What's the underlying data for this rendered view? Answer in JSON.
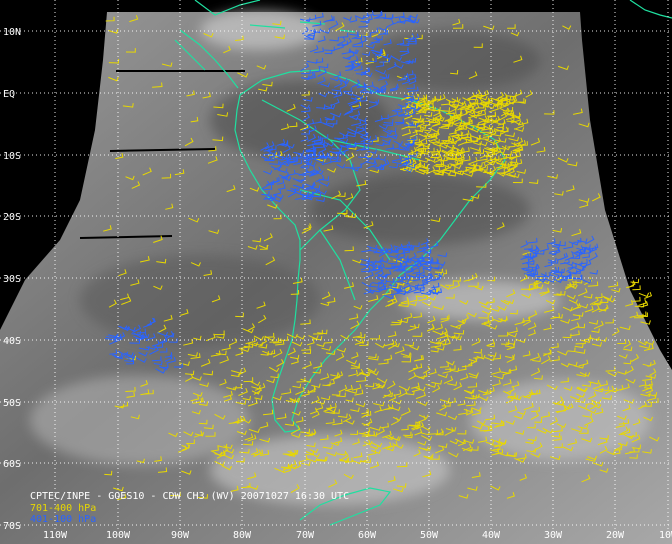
{
  "caption": "CPTEC/INPE - GOES10 - CDW CH3 (WV) 20071027 16:30 UTC",
  "legend": [
    {
      "label": "701-400 hPa",
      "color": "#e8d800"
    },
    {
      "label": "401-100 hPa",
      "color": "#2a64ff"
    }
  ],
  "lat_labels": [
    "10N",
    "EQ",
    "10S",
    "20S",
    "30S",
    "40S",
    "50S",
    "60S",
    "70S"
  ],
  "lon_labels": [
    "110W",
    "100W",
    "90W",
    "80W",
    "70W",
    "60W",
    "50W",
    "40W",
    "30W",
    "20W",
    "10W"
  ],
  "colors": {
    "background": "#000000",
    "coast": "#1fe0a0",
    "grid": "#ffffff",
    "image_gray": "#8c8c8c"
  },
  "wind_layers": [
    {
      "name": "701-400 hPa",
      "color": "#e8d800",
      "count": 1400
    },
    {
      "name": "401-100 hPa",
      "color": "#2a64ff",
      "count": 700
    }
  ]
}
